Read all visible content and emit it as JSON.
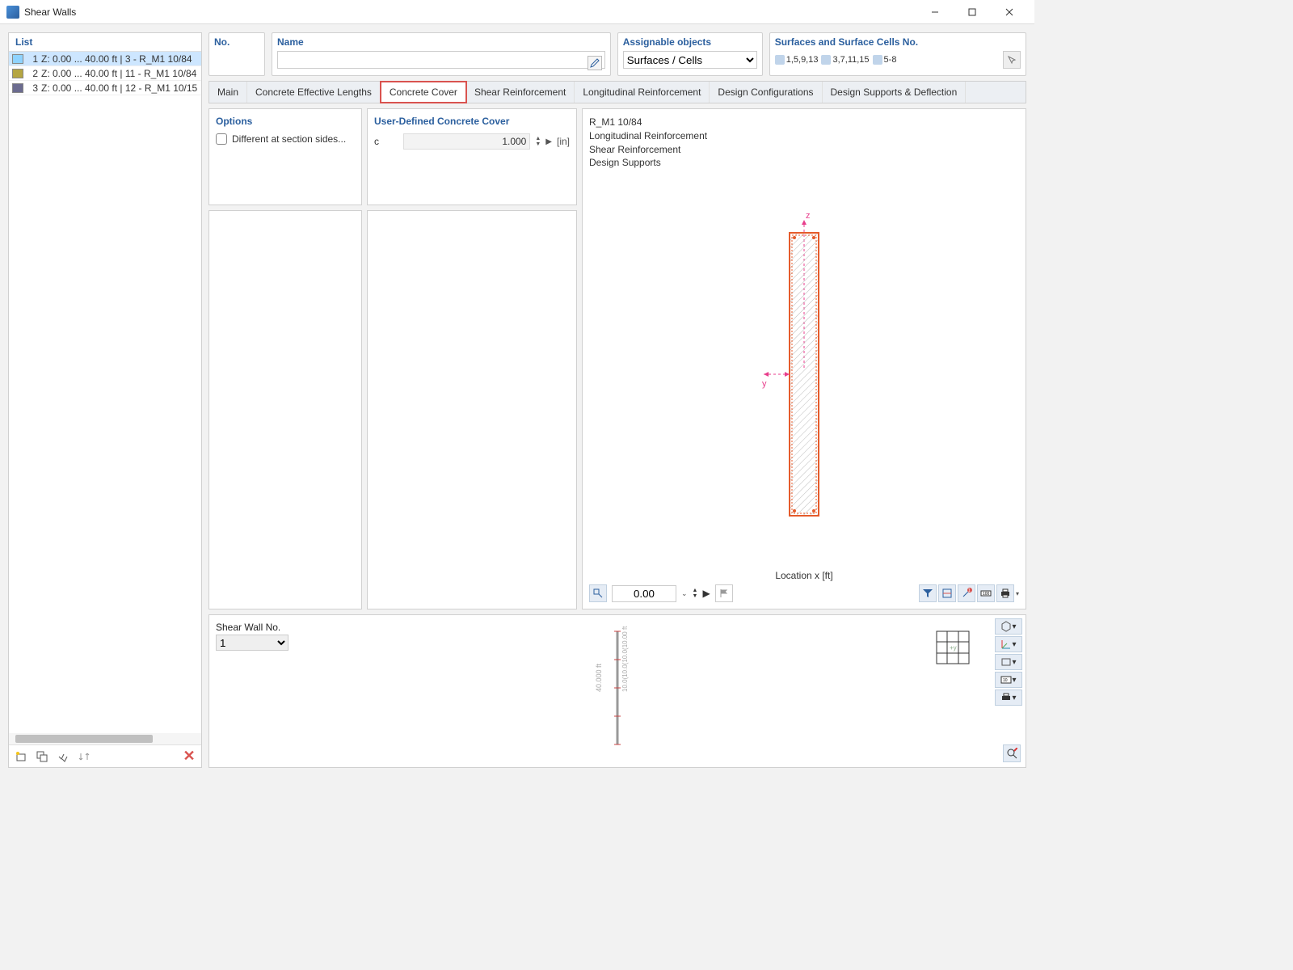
{
  "window": {
    "title": "Shear Walls"
  },
  "list": {
    "header": "List",
    "rows": [
      {
        "num": "1",
        "text": "Z: 0.00 ... 40.00 ft | 3 - R_M1 10/84",
        "color": "#8fd3ff",
        "selected": true
      },
      {
        "num": "2",
        "text": "Z: 0.00 ... 40.00 ft | 11 - R_M1 10/84",
        "color": "#b5a642",
        "selected": false
      },
      {
        "num": "3",
        "text": "Z: 0.00 ... 40.00 ft | 12 - R_M1 10/15",
        "color": "#6b6b8f",
        "selected": false
      }
    ]
  },
  "header": {
    "no_label": "No.",
    "name_label": "Name",
    "name_value": "",
    "assignable_label": "Assignable objects",
    "assignable_value": "Surfaces / Cells",
    "surfaces_label": "Surfaces and Surface Cells No.",
    "surf_groups": [
      "1,5,9,13",
      "3,7,11,15",
      "5-8"
    ]
  },
  "tabs": [
    "Main",
    "Concrete Effective Lengths",
    "Concrete Cover",
    "Shear Reinforcement",
    "Longitudinal Reinforcement",
    "Design Configurations",
    "Design Supports & Deflection"
  ],
  "active_tab": 2,
  "options": {
    "header": "Options",
    "different_label": "Different at section sides..."
  },
  "cover": {
    "header": "User-Defined Concrete Cover",
    "c_label": "c",
    "c_value": "1.000",
    "c_unit": "[in]"
  },
  "info": {
    "lines": [
      "R_M1 10/84",
      "Longitudinal Reinforcement",
      "Shear Reinforcement",
      "Design Supports"
    ]
  },
  "location": {
    "label": "Location x [ft]",
    "value": "0.00"
  },
  "bottom": {
    "label": "Shear Wall No.",
    "value": "1",
    "elev_text": "40.000 ft",
    "elev_sub": "10.0(10.0(10.0(10.00 ft"
  }
}
